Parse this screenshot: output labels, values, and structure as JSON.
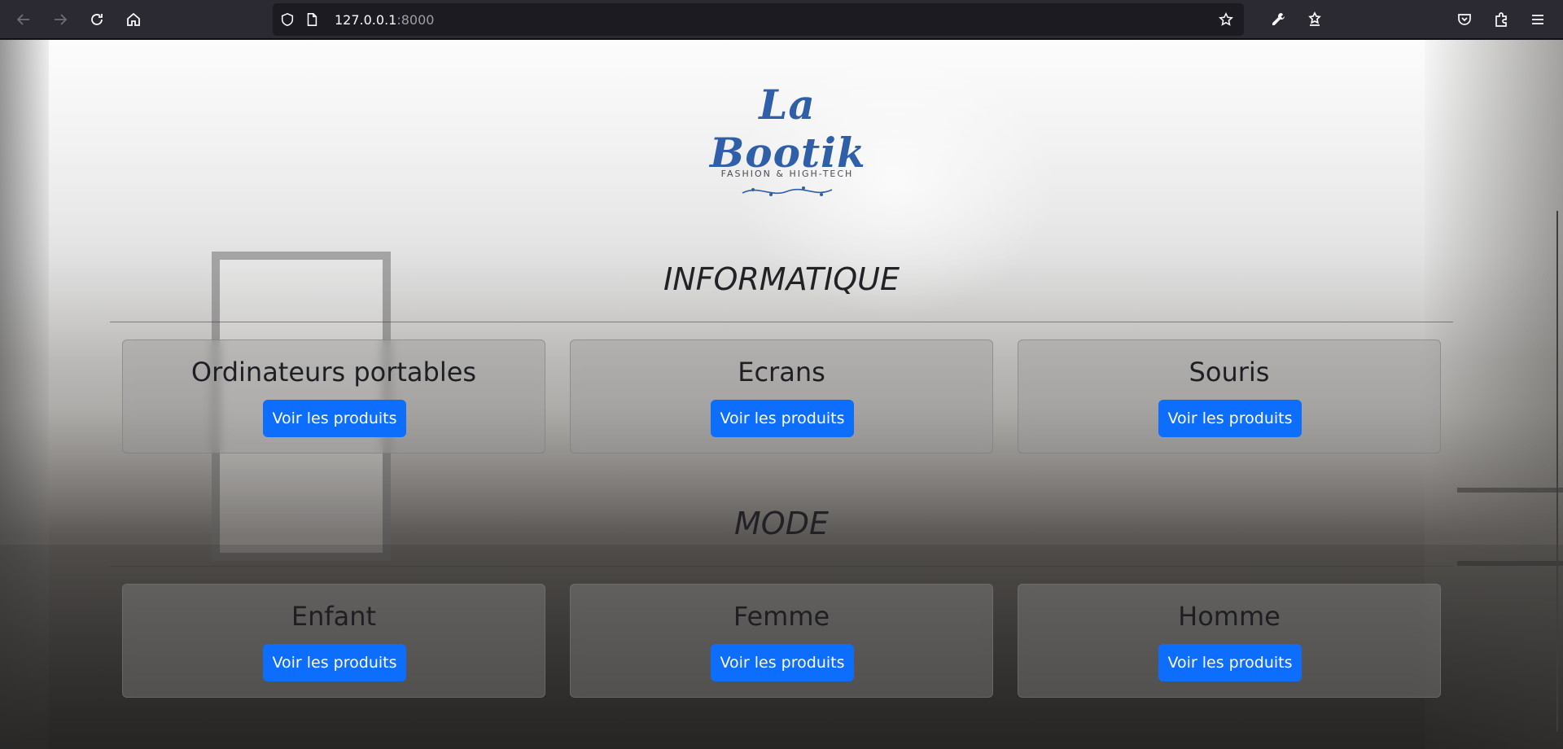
{
  "browser": {
    "url_host": "127.0.0.1",
    "url_port": ":8000",
    "icons": [
      "back-arrow-icon",
      "forward-arrow-icon",
      "reload-icon",
      "home-icon",
      "shield-icon",
      "page-icon",
      "bookmark-star-icon",
      "wrench-icon",
      "reader-icon",
      "pocket-icon",
      "extensions-icon",
      "menu-icon"
    ]
  },
  "logo": {
    "script": "La Bootik",
    "tagline": "FASHION & HIGH-TECH"
  },
  "sections": [
    {
      "title": "INFORMATIQUE",
      "cards": [
        {
          "title": "Ordinateurs portables",
          "button": "Voir les produits"
        },
        {
          "title": "Ecrans",
          "button": "Voir les produits"
        },
        {
          "title": "Souris",
          "button": "Voir les produits"
        }
      ]
    },
    {
      "title": "MODE",
      "cards": [
        {
          "title": "Enfant",
          "button": "Voir les produits"
        },
        {
          "title": "Femme",
          "button": "Voir les produits"
        },
        {
          "title": "Homme",
          "button": "Voir les produits"
        }
      ]
    }
  ],
  "colors": {
    "button_primary": "#0d6efd",
    "logo_blue": "#2e5fa8"
  }
}
